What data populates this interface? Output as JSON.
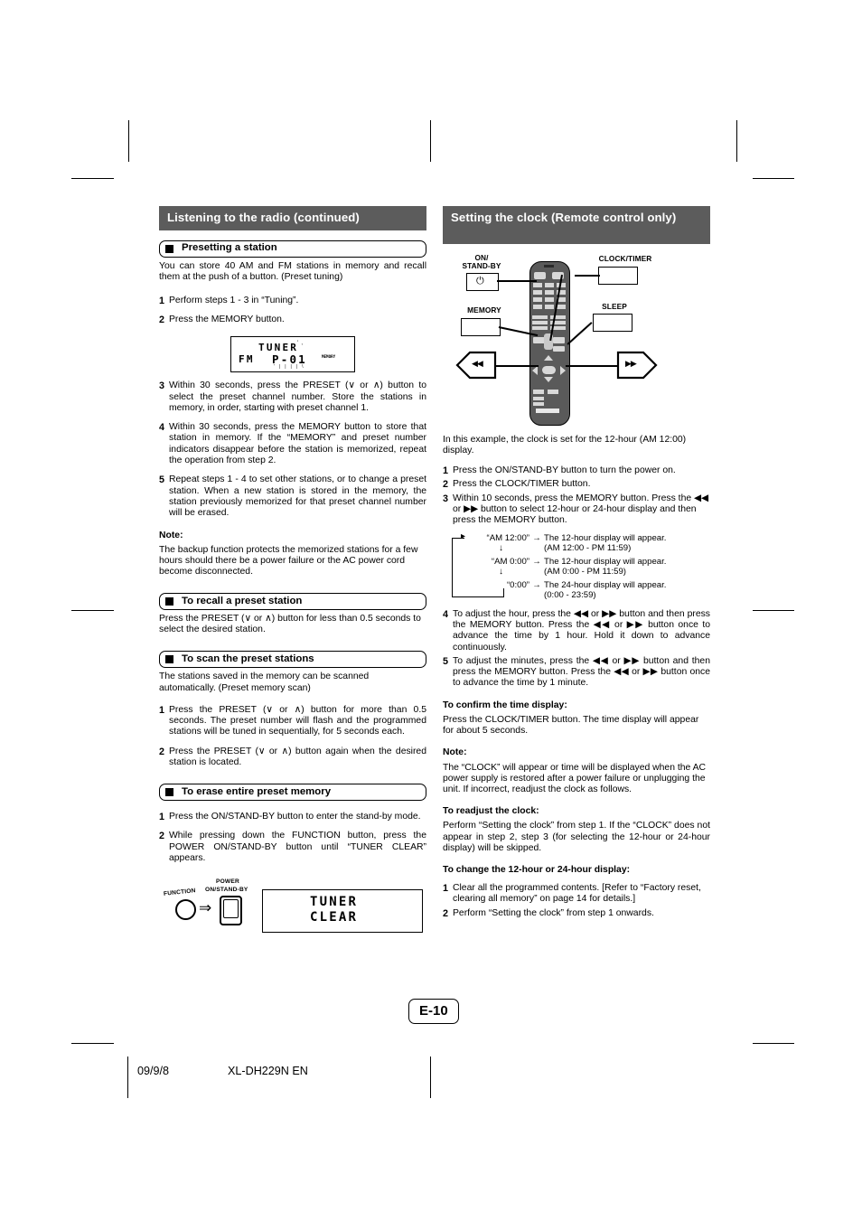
{
  "left_column": {
    "banner": "Listening to the radio (continued)",
    "section_presetting": {
      "heading": "Presetting a station",
      "intro": "You can store 40 AM and FM stations in memory and recall them at the push of a button. (Preset tuning)",
      "steps": [
        {
          "n": "1",
          "text": "Perform steps 1 - 3 in “Tuning”."
        },
        {
          "n": "2",
          "text": "Press the MEMORY button."
        }
      ],
      "lcd": {
        "tuner": "TUNER",
        "fm": "FM",
        "preset": "P-01",
        "memory_indicator": "MEMORY"
      },
      "steps2": [
        {
          "n": "3",
          "text": "Within 30 seconds, press the PRESET (∨ or ∧) button to select the preset channel number. Store the stations in memory, in order, starting with preset channel 1."
        },
        {
          "n": "4",
          "text": "Within 30 seconds, press the MEMORY button to store that station in memory. If the “MEMORY” and preset number indicators disappear before the station is memorized, repeat the operation from step 2."
        },
        {
          "n": "5",
          "text": "Repeat steps 1 - 4 to set other stations, or to change a preset station. When a new station is stored in the memory, the station previously memorized for that preset channel number will be erased."
        }
      ],
      "note_label": "Note:",
      "note_text": "The backup function protects the memorized stations for a few hours should there be a power failure or the AC power cord become disconnected."
    },
    "section_recall": {
      "heading": "To recall a preset station",
      "text": "Press the PRESET (∨ or ∧) button for less than 0.5 seconds to select the desired station."
    },
    "section_scan": {
      "heading": "To scan the preset stations",
      "text": "The stations saved in the memory can be scanned automatically. (Preset memory scan)",
      "steps": [
        {
          "n": "1",
          "text": "Press the PRESET (∨ or ∧) button for more than 0.5 seconds. The preset number will flash and the programmed stations will be tuned in sequentially, for 5 seconds each."
        },
        {
          "n": "2",
          "text": "Press the PRESET (∨ or ∧) button again when the desired station is located."
        }
      ]
    },
    "section_erase": {
      "heading": "To erase entire preset memory",
      "steps": [
        {
          "n": "1",
          "text": "Press the ON/STAND-BY button to enter the stand-by mode."
        },
        {
          "n": "2",
          "text": "While pressing down the FUNCTION button, press the POWER ON/STAND-BY button until “TUNER CLEAR” appears."
        }
      ],
      "diagram": {
        "function_label": "FUNCTION",
        "power_label_line1": "POWER",
        "power_label_line2": "ON/STAND-BY",
        "lcd_line1": "TUNER",
        "lcd_line2": "CLEAR"
      }
    }
  },
  "right_column": {
    "banner": "Setting the clock (Remote control only)",
    "remote": {
      "callout_onstandby_line1": "ON/",
      "callout_onstandby_line2": "STAND-BY",
      "callout_clocktimer": "CLOCK/TIMER",
      "callout_memory": "MEMORY",
      "callout_sleep": "SLEEP",
      "skip_back": "◀◀",
      "skip_fwd": "▶▶",
      "power_symbol": "⏻"
    },
    "intro": "In this example, the clock is set for the 12-hour (AM 12:00) display.",
    "steps": [
      {
        "n": "1",
        "text": "Press the ON/STAND-BY button to turn the power on."
      },
      {
        "n": "2",
        "text": "Press the CLOCK/TIMER button."
      },
      {
        "n": "3",
        "text": "Within 10 seconds, press the MEMORY button. Press the ◀◀ or ▶▶ button to select 12-hour or 24-hour display and then press the MEMORY button."
      }
    ],
    "cycle": [
      {
        "value": "“AM 12:00”",
        "desc_line1": "The 12-hour display will appear.",
        "desc_line2": "(AM 12:00 - PM 11:59)"
      },
      {
        "value": "“AM 0:00”",
        "desc_line1": "The 12-hour display will appear.",
        "desc_line2": "(AM 0:00 - PM 11:59)"
      },
      {
        "value": "“0:00”",
        "desc_line1": "The 24-hour display will appear.",
        "desc_line2": "(0:00 - 23:59)"
      }
    ],
    "steps2": [
      {
        "n": "4",
        "text": "To adjust the hour, press the ◀◀ or ▶▶ button and then press the MEMORY button. Press the ◀◀ or ▶▶ button once to advance the time by 1 hour. Hold it down to advance continuously."
      },
      {
        "n": "5",
        "text": "To adjust the minutes, press the ◀◀ or ▶▶ button and then press the MEMORY button. Press the ◀◀ or ▶▶ button once to advance the time by 1 minute."
      }
    ],
    "confirm_label": "To confirm the time display:",
    "confirm_text": "Press the CLOCK/TIMER button. The time display will appear for about 5 seconds.",
    "note_label": "Note:",
    "note_text": "The “CLOCK” will appear or time will be displayed when the AC power supply is restored after a power failure or unplugging the unit. If incorrect, readjust the clock as follows.",
    "readjust_label": "To readjust the clock:",
    "readjust_text": "Perform “Setting the clock” from step 1. If the “CLOCK” does not appear in step 2, step 3 (for selecting the 12-hour or 24-hour display) will be skipped.",
    "change_label": "To change the 12-hour or 24-hour display:",
    "change_steps": [
      {
        "n": "1",
        "text": "Clear all the programmed contents. [Refer to “Factory reset, clearing all memory” on page 14 for details.]"
      },
      {
        "n": "2",
        "text": "Perform “Setting the clock” from step 1 onwards."
      }
    ]
  },
  "footer": {
    "page_number": "E-10",
    "date": "09/9/8",
    "model": "XL-DH229N EN"
  }
}
